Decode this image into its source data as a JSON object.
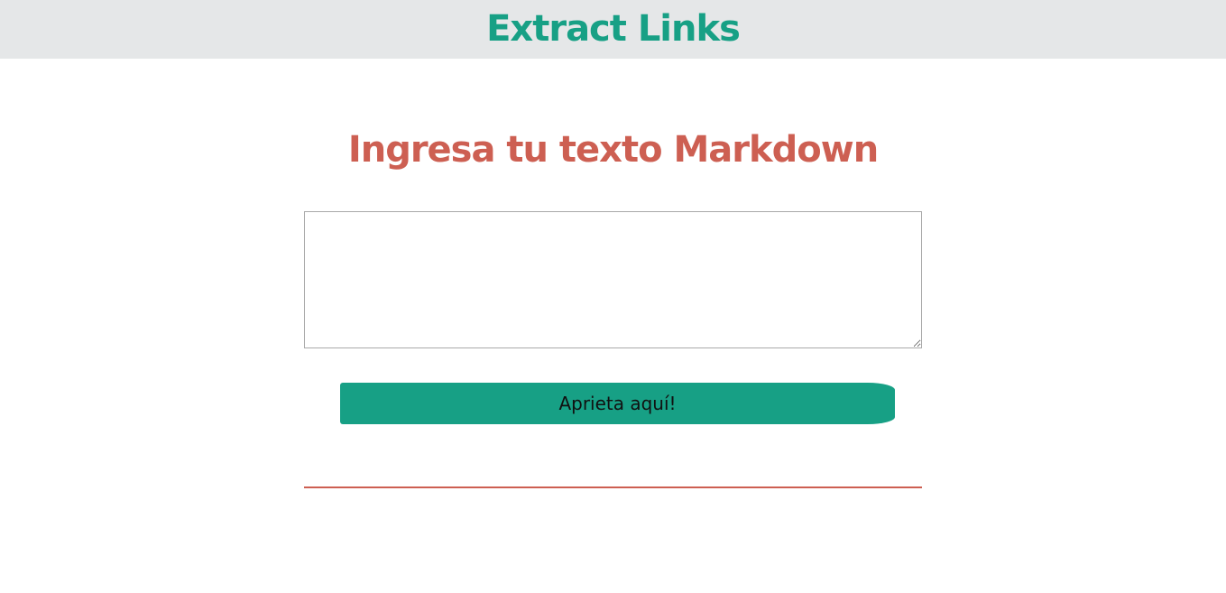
{
  "header": {
    "title": "Extract Links",
    "background_color": "#e5e7e8",
    "title_color": "#17a085"
  },
  "main": {
    "heading": "Ingresa tu texto Markdown",
    "heading_color": "#cd5f52",
    "markdown_input": {
      "value": "",
      "placeholder": ""
    },
    "submit_button": {
      "label": "Aprieta aquí!",
      "color": "#17a085"
    },
    "divider_color": "#cd5f52",
    "results": []
  }
}
